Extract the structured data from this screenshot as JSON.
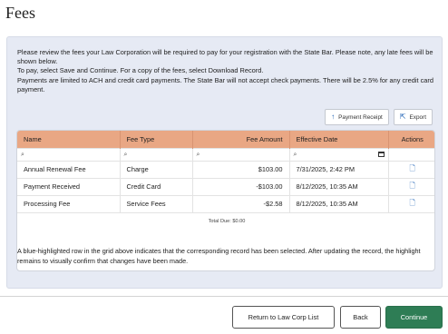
{
  "page": {
    "title": "Fees"
  },
  "intro": {
    "p1": "Please review the fees your Law Corporation will be required to pay for your registration with the State Bar. Please note, any late fees will be shown below.",
    "p2": "To pay, select Save and Continue. For a copy of the fees, select Download Record.",
    "p3": "Payments are limited to ACH and credit card payments. The State Bar will not accept check payments. There will be 2.5% for any credit card payment."
  },
  "toolbar": {
    "payment_receipt": "Payment Receipt",
    "export": "Export",
    "payment_receipt_icon": "arrow-up-icon",
    "export_icon": "export-icon"
  },
  "grid": {
    "columns": [
      "Name",
      "Fee Type",
      "Fee Amount",
      "Effective Date",
      "Actions"
    ],
    "rows": [
      {
        "name": "Annual Renewal Fee",
        "fee_type": "Charge",
        "fee_amount": "$103.00",
        "effective_date": "7/31/2025, 2:42 PM",
        "action_icon": "document-icon"
      },
      {
        "name": "Payment Received",
        "fee_type": "Credit Card",
        "fee_amount": "-$103.00",
        "effective_date": "8/12/2025, 10:35 AM",
        "action_icon": "document-icon"
      },
      {
        "name": "Processing Fee",
        "fee_type": "Service Fees",
        "fee_amount": "-$2.58",
        "effective_date": "8/12/2025, 10:35 AM",
        "action_icon": "document-icon"
      }
    ],
    "total": "Total Due: $0.00"
  },
  "note": "A blue-highlighted row in the grid above indicates that the corresponding record has been selected. After updating the record, the highlight remains to visually confirm that changes have been made.",
  "footer": {
    "return_label": "Return to Law Corp List",
    "back_label": "Back",
    "continue_label": "Continue"
  },
  "colors": {
    "header_bg": "#e9a784",
    "panel_bg": "#e6eaf4",
    "primary_button": "#2e7d55",
    "icon_blue": "#1a5fb4"
  }
}
